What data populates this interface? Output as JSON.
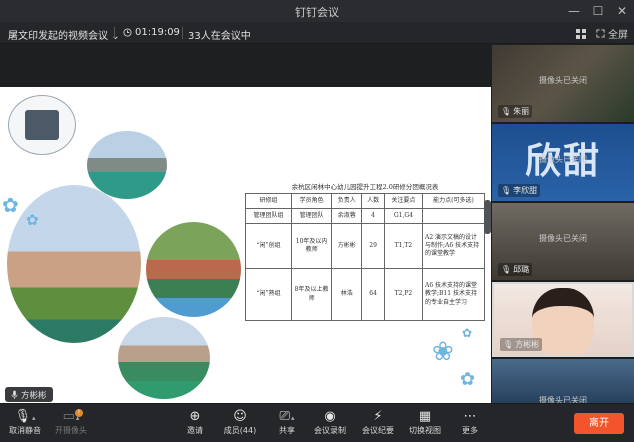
{
  "window": {
    "title": "钉钉会议",
    "minimize_glyph": "—",
    "maximize_glyph": "☐",
    "close_glyph": "✕"
  },
  "infobar": {
    "meeting_name": "屠文印发起的视频会议",
    "meeting_caret": "⌄",
    "duration": "01:19:09",
    "participants_in_meeting": "33人在会议中",
    "view_toggle_label": "",
    "fullscreen_label": "全屏"
  },
  "slide": {
    "table_title": "余杭区闲林中心幼儿园提升工程2.0研修分团概况表",
    "headers": [
      "研修组",
      "学员角色",
      "负责人",
      "人数",
      "关注要点",
      "能力点(可多选)"
    ],
    "rows": [
      [
        "管理团队组",
        "管理团队",
        "余淑蓉",
        "4",
        "G1,G4",
        ""
      ],
      [
        "“闲”创组",
        "10年及以内教师",
        "方彬彬",
        "29",
        "T1,T2",
        "A2 演示文稿的设计与制作;A6 技术支持的课堂教学"
      ],
      [
        "“闲”熟组",
        "8年及以上教师",
        "林浩",
        "64",
        "T2,P2",
        "A6 技术支持的课堂教学;B11 技术支持的专业自主学习"
      ]
    ],
    "logo_icon": "school-logo-icon"
  },
  "speaker_indicator": {
    "name": "方彬彬"
  },
  "participants": [
    {
      "name": "朱丽",
      "status": "摄像头已关闭",
      "big_text": ""
    },
    {
      "name": "李欣甜",
      "status": "摄像头已关闭",
      "big_text": "欣甜"
    },
    {
      "name": "邱璐",
      "status": "摄像头已关闭",
      "big_text": ""
    },
    {
      "name": "方彬彬",
      "status": "",
      "big_text": ""
    },
    {
      "name": "",
      "status": "摄像头已关闭",
      "big_text": ""
    }
  ],
  "toolbar": {
    "mute_label": "取消静音",
    "camera_label": "开摄像头",
    "camera_badge": "!",
    "invite_label": "邀请",
    "members_label": "成员(44)",
    "share_label": "共享",
    "record_label": "会议录制",
    "minutes_label": "会议纪要",
    "switch_view_label": "切换视图",
    "more_label": "更多",
    "leave_label": "离开"
  },
  "colors": {
    "leave_button": "#f2552c",
    "badge": "#e08a24",
    "background": "#1f2022"
  }
}
